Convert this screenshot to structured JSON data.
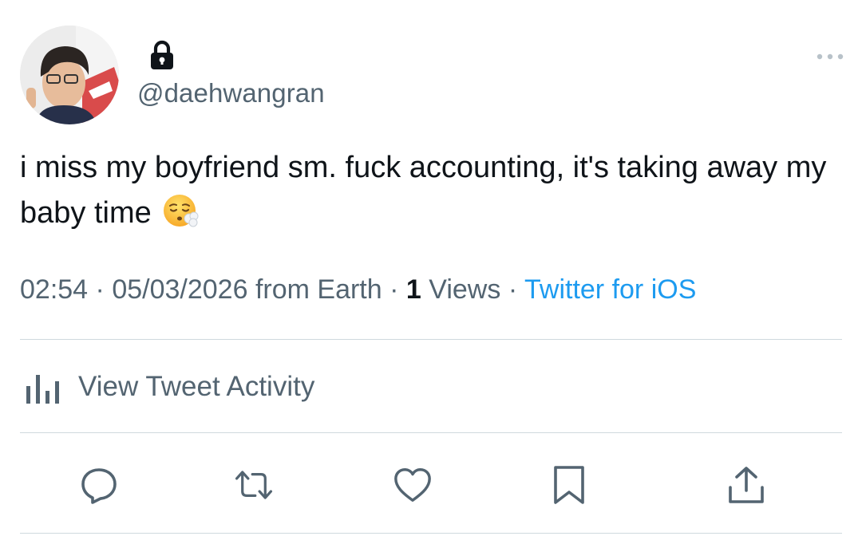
{
  "tweet": {
    "handle": "@daehwangran",
    "text": "i miss my boyfriend sm. fuck accounting, it's taking away my baby time",
    "emoji": "face-exhaling-emoji",
    "locked": true
  },
  "meta": {
    "time": "02:54",
    "date": "05/03/2026",
    "location": "from Earth",
    "views_count": "1",
    "views_label": "Views",
    "source": "Twitter for iOS",
    "separator": "·"
  },
  "activity": {
    "label": "View Tweet Activity"
  },
  "actions": [
    {
      "name": "reply",
      "icon": "reply-icon"
    },
    {
      "name": "retweet",
      "icon": "retweet-icon"
    },
    {
      "name": "like",
      "icon": "heart-icon"
    },
    {
      "name": "bookmark",
      "icon": "bookmark-icon"
    },
    {
      "name": "share",
      "icon": "share-icon"
    }
  ],
  "colors": {
    "text": "#0f1419",
    "secondary": "#536471",
    "link": "#1d9bf0",
    "divider": "#cfd9de"
  }
}
